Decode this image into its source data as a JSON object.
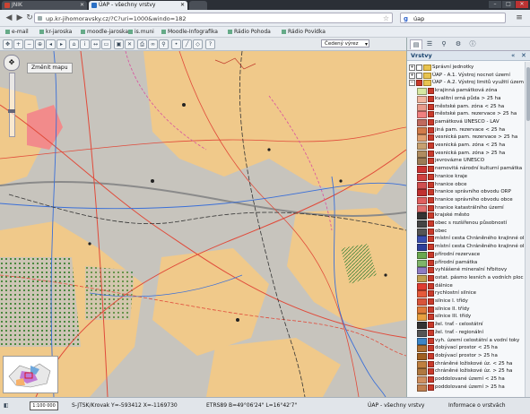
{
  "browser": {
    "tabs": [
      {
        "label": "JNIK"
      },
      {
        "label": "ÚAP - všechny vrstvy"
      },
      {
        "label": ""
      }
    ],
    "url": "up.kr-jihomoravsky.cz/?C?uri=1000&windo=182",
    "search_text": "úap",
    "bookmarks": [
      {
        "label": "e-mail"
      },
      {
        "label": "kr-jaroska"
      },
      {
        "label": "moodle-jaroska"
      },
      {
        "label": "is.muni"
      },
      {
        "label": "Moodle-Infografika"
      },
      {
        "label": "Rádio Pohoda"
      },
      {
        "label": "Rádio Povídka"
      }
    ]
  },
  "map": {
    "extent_button": "Změnit mapu",
    "scale_combo": "Čedený výrez"
  },
  "panel": {
    "title": "Vrstvy",
    "layers": [
      {
        "label": "Správní jednotky",
        "level": 0,
        "type": "folder",
        "checked": false
      },
      {
        "label": "ÚAP - A.1. Výstroj nocnot území",
        "level": 0,
        "type": "folder",
        "checked": false
      },
      {
        "label": "ÚAP - A.2. Výstroj limitů využití území",
        "level": 0,
        "type": "folder",
        "checked": true
      },
      {
        "label": "krajinná památková zóna",
        "level": 1,
        "color": "#d7e8a2"
      },
      {
        "label": "kvalitní orná půda > 25 ha",
        "level": 1,
        "color": "#f1b6a0"
      },
      {
        "label": "městské pam. zóna < 25 ha",
        "level": 1,
        "color": "#e89b8c"
      },
      {
        "label": "městské pam. rezervace > 25 ha",
        "level": 1,
        "color": "#f08080"
      },
      {
        "label": "památková UNESCO - LAV",
        "level": 1,
        "color": "#c06a5e"
      },
      {
        "label": "jiná pam. rezervace < 25 ha",
        "level": 1,
        "color": "#d27b4a"
      },
      {
        "label": "vesnická pam. rezervace > 25 ha",
        "level": 1,
        "color": "#e0a070"
      },
      {
        "label": "vesnická pam. zóna < 25 ha",
        "level": 1,
        "color": "#c7a070"
      },
      {
        "label": "vesnická pam. zóna > 25 ha",
        "level": 1,
        "color": "#b08c60"
      },
      {
        "label": "jevrovázne UNESCO",
        "level": 1,
        "color": "#9c7b56"
      },
      {
        "label": "nemovitá národní kulturní památka",
        "level": 1,
        "color": "#cc3333"
      },
      {
        "label": "hranice kraje",
        "level": 1,
        "color": "#d04040"
      },
      {
        "label": "hranice obce",
        "level": 1,
        "color": "#d05050"
      },
      {
        "label": "hranice správního obvodu ORP",
        "level": 1,
        "color": "#c03030"
      },
      {
        "label": "hranice správního obvodu obce",
        "level": 1,
        "color": "#e06060"
      },
      {
        "label": "hranice katastrálního území",
        "level": 1,
        "color": "#e07070"
      },
      {
        "label": "krajské město",
        "level": 1,
        "color": "#333333"
      },
      {
        "label": "obec s rozšířenou působností",
        "level": 1,
        "color": "#444444"
      },
      {
        "label": "obec",
        "level": 1,
        "color": "#555555"
      },
      {
        "label": "místní cesta Chráněného krajinné oblasti",
        "level": 1,
        "color": "#3a4fb0"
      },
      {
        "label": "místní cesta Chráněného krajinné oblasti",
        "level": 1,
        "color": "#2d3f9a"
      },
      {
        "label": "přírodní rezervace",
        "level": 1,
        "color": "#6aa84f"
      },
      {
        "label": "přírodní památka",
        "level": 1,
        "color": "#7fb56a"
      },
      {
        "label": "vyhlášené mineralní hřbitovy",
        "level": 1,
        "color": "#8e7cc3"
      },
      {
        "label": "ostat. pásmo lesních a vodních ploch",
        "level": 1,
        "color": "#c0a050"
      },
      {
        "label": "dálnice",
        "level": 1,
        "color": "#e03c31"
      },
      {
        "label": "rychlostní silnice",
        "level": 1,
        "color": "#e65a3a"
      },
      {
        "label": "silnice I. třídy",
        "level": 1,
        "color": "#d9543a"
      },
      {
        "label": "silnice II. třídy",
        "level": 1,
        "color": "#e07b3a"
      },
      {
        "label": "silnice III. třídy",
        "level": 1,
        "color": "#e8a040"
      },
      {
        "label": "žel. trať - celostátní",
        "level": 1,
        "color": "#333333"
      },
      {
        "label": "žel. trať - regionální",
        "level": 1,
        "color": "#555555"
      },
      {
        "label": "vyh. území celostátní a vodní toky",
        "level": 1,
        "color": "#3d85c6"
      },
      {
        "label": "dobývací prostor < 25 ha",
        "level": 1,
        "color": "#b07030"
      },
      {
        "label": "dobývací prostor > 25 ha",
        "level": 1,
        "color": "#a06020"
      },
      {
        "label": "chráněné ložiskové úz. < 25 ha",
        "level": 1,
        "color": "#c08040"
      },
      {
        "label": "chráněné ložiskové úz. > 25 ha",
        "level": 1,
        "color": "#b07840"
      },
      {
        "label": "poddolované území < 25 ha",
        "level": 1,
        "color": "#d09060"
      },
      {
        "label": "poddolované území > 25 ha",
        "level": 1,
        "color": "#c08050"
      }
    ]
  },
  "status": {
    "scale": "1:100 000",
    "coords_left": "S-JTSK/Krovak   Y=-593412  X=-1169730",
    "coords_right": "ETRS89   B=49°06'24\" L=16°42'7\"",
    "title": "ÚAP - všechny vrstvy",
    "info": "Informace o vrstvách"
  },
  "colors": {
    "map_base": "#c7c4bd",
    "built_area": "#f0c98a",
    "roads": "#e04a3a",
    "rivers": "#3a6fd8",
    "hatch": "#2e7d32"
  }
}
